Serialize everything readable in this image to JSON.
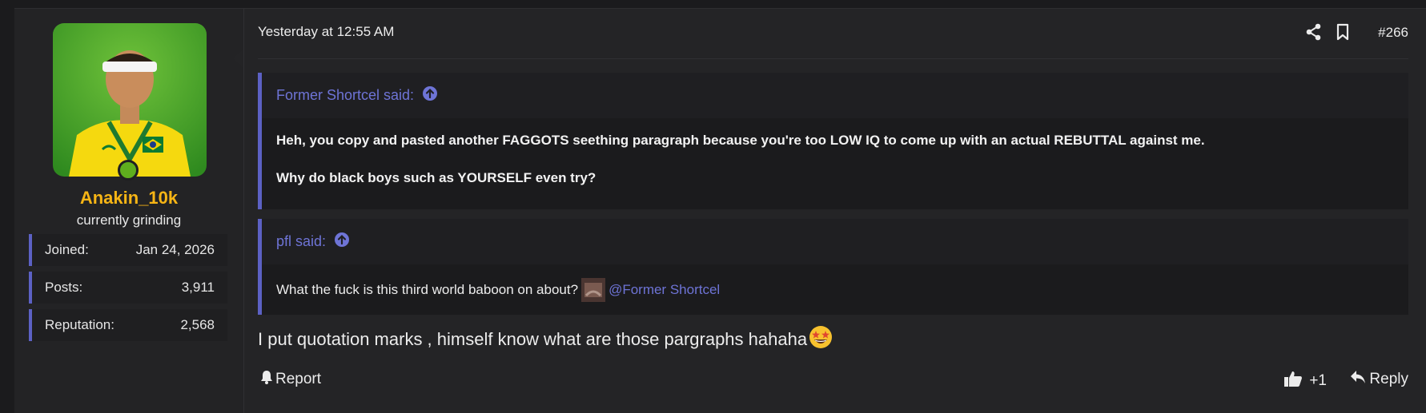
{
  "user": {
    "name": "Anakin_10k",
    "title": "currently grinding",
    "stats": [
      {
        "label": "Joined:",
        "value": "Jan 24, 2026"
      },
      {
        "label": "Posts:",
        "value": "3,911"
      },
      {
        "label": "Reputation:",
        "value": "2,568"
      }
    ]
  },
  "post": {
    "date": "Yesterday at 12:55 AM",
    "number": "#266",
    "quotes": [
      {
        "author": "Former Shortcel said:",
        "lines": [
          "Heh, you copy and pasted another FAGGOTS seething paragraph because you're too LOW IQ to come up with an actual REBUTTAL against me.",
          "Why do black boys such as YOURSELF even try?"
        ]
      },
      {
        "author": "pfl said:",
        "text": "What the fuck is this third world baboon on about?",
        "mention": "@Former Shortcel"
      }
    ],
    "body": "I put quotation marks , himself know what are those pargraphs hahaha"
  },
  "footer": {
    "report": "Report",
    "like_count": "+1",
    "reply": "Reply"
  },
  "icons": {
    "share": "share-icon",
    "bookmark": "bookmark-icon",
    "up_arrow": "arrow-circle-up-icon",
    "emoji": "grinning-star-eyes-emoji"
  },
  "colors": {
    "accent": "#5c61c4",
    "link": "#6e74d6",
    "username": "#f7b515",
    "online": "#5fae1e"
  }
}
